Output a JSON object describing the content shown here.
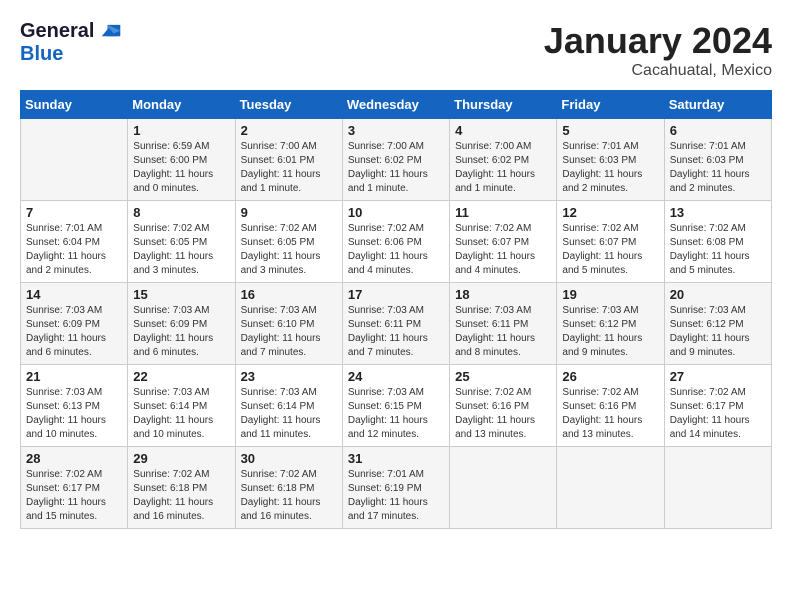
{
  "header": {
    "logo_line1": "General",
    "logo_line2": "Blue",
    "month": "January 2024",
    "location": "Cacahuatal, Mexico"
  },
  "days_of_week": [
    "Sunday",
    "Monday",
    "Tuesday",
    "Wednesday",
    "Thursday",
    "Friday",
    "Saturday"
  ],
  "weeks": [
    [
      {
        "day": "",
        "info": ""
      },
      {
        "day": "1",
        "info": "Sunrise: 6:59 AM\nSunset: 6:00 PM\nDaylight: 11 hours\nand 0 minutes."
      },
      {
        "day": "2",
        "info": "Sunrise: 7:00 AM\nSunset: 6:01 PM\nDaylight: 11 hours\nand 1 minute."
      },
      {
        "day": "3",
        "info": "Sunrise: 7:00 AM\nSunset: 6:02 PM\nDaylight: 11 hours\nand 1 minute."
      },
      {
        "day": "4",
        "info": "Sunrise: 7:00 AM\nSunset: 6:02 PM\nDaylight: 11 hours\nand 1 minute."
      },
      {
        "day": "5",
        "info": "Sunrise: 7:01 AM\nSunset: 6:03 PM\nDaylight: 11 hours\nand 2 minutes."
      },
      {
        "day": "6",
        "info": "Sunrise: 7:01 AM\nSunset: 6:03 PM\nDaylight: 11 hours\nand 2 minutes."
      }
    ],
    [
      {
        "day": "7",
        "info": "Sunrise: 7:01 AM\nSunset: 6:04 PM\nDaylight: 11 hours\nand 2 minutes."
      },
      {
        "day": "8",
        "info": "Sunrise: 7:02 AM\nSunset: 6:05 PM\nDaylight: 11 hours\nand 3 minutes."
      },
      {
        "day": "9",
        "info": "Sunrise: 7:02 AM\nSunset: 6:05 PM\nDaylight: 11 hours\nand 3 minutes."
      },
      {
        "day": "10",
        "info": "Sunrise: 7:02 AM\nSunset: 6:06 PM\nDaylight: 11 hours\nand 4 minutes."
      },
      {
        "day": "11",
        "info": "Sunrise: 7:02 AM\nSunset: 6:07 PM\nDaylight: 11 hours\nand 4 minutes."
      },
      {
        "day": "12",
        "info": "Sunrise: 7:02 AM\nSunset: 6:07 PM\nDaylight: 11 hours\nand 5 minutes."
      },
      {
        "day": "13",
        "info": "Sunrise: 7:02 AM\nSunset: 6:08 PM\nDaylight: 11 hours\nand 5 minutes."
      }
    ],
    [
      {
        "day": "14",
        "info": "Sunrise: 7:03 AM\nSunset: 6:09 PM\nDaylight: 11 hours\nand 6 minutes."
      },
      {
        "day": "15",
        "info": "Sunrise: 7:03 AM\nSunset: 6:09 PM\nDaylight: 11 hours\nand 6 minutes."
      },
      {
        "day": "16",
        "info": "Sunrise: 7:03 AM\nSunset: 6:10 PM\nDaylight: 11 hours\nand 7 minutes."
      },
      {
        "day": "17",
        "info": "Sunrise: 7:03 AM\nSunset: 6:11 PM\nDaylight: 11 hours\nand 7 minutes."
      },
      {
        "day": "18",
        "info": "Sunrise: 7:03 AM\nSunset: 6:11 PM\nDaylight: 11 hours\nand 8 minutes."
      },
      {
        "day": "19",
        "info": "Sunrise: 7:03 AM\nSunset: 6:12 PM\nDaylight: 11 hours\nand 9 minutes."
      },
      {
        "day": "20",
        "info": "Sunrise: 7:03 AM\nSunset: 6:12 PM\nDaylight: 11 hours\nand 9 minutes."
      }
    ],
    [
      {
        "day": "21",
        "info": "Sunrise: 7:03 AM\nSunset: 6:13 PM\nDaylight: 11 hours\nand 10 minutes."
      },
      {
        "day": "22",
        "info": "Sunrise: 7:03 AM\nSunset: 6:14 PM\nDaylight: 11 hours\nand 10 minutes."
      },
      {
        "day": "23",
        "info": "Sunrise: 7:03 AM\nSunset: 6:14 PM\nDaylight: 11 hours\nand 11 minutes."
      },
      {
        "day": "24",
        "info": "Sunrise: 7:03 AM\nSunset: 6:15 PM\nDaylight: 11 hours\nand 12 minutes."
      },
      {
        "day": "25",
        "info": "Sunrise: 7:02 AM\nSunset: 6:16 PM\nDaylight: 11 hours\nand 13 minutes."
      },
      {
        "day": "26",
        "info": "Sunrise: 7:02 AM\nSunset: 6:16 PM\nDaylight: 11 hours\nand 13 minutes."
      },
      {
        "day": "27",
        "info": "Sunrise: 7:02 AM\nSunset: 6:17 PM\nDaylight: 11 hours\nand 14 minutes."
      }
    ],
    [
      {
        "day": "28",
        "info": "Sunrise: 7:02 AM\nSunset: 6:17 PM\nDaylight: 11 hours\nand 15 minutes."
      },
      {
        "day": "29",
        "info": "Sunrise: 7:02 AM\nSunset: 6:18 PM\nDaylight: 11 hours\nand 16 minutes."
      },
      {
        "day": "30",
        "info": "Sunrise: 7:02 AM\nSunset: 6:18 PM\nDaylight: 11 hours\nand 16 minutes."
      },
      {
        "day": "31",
        "info": "Sunrise: 7:01 AM\nSunset: 6:19 PM\nDaylight: 11 hours\nand 17 minutes."
      },
      {
        "day": "",
        "info": ""
      },
      {
        "day": "",
        "info": ""
      },
      {
        "day": "",
        "info": ""
      }
    ]
  ]
}
